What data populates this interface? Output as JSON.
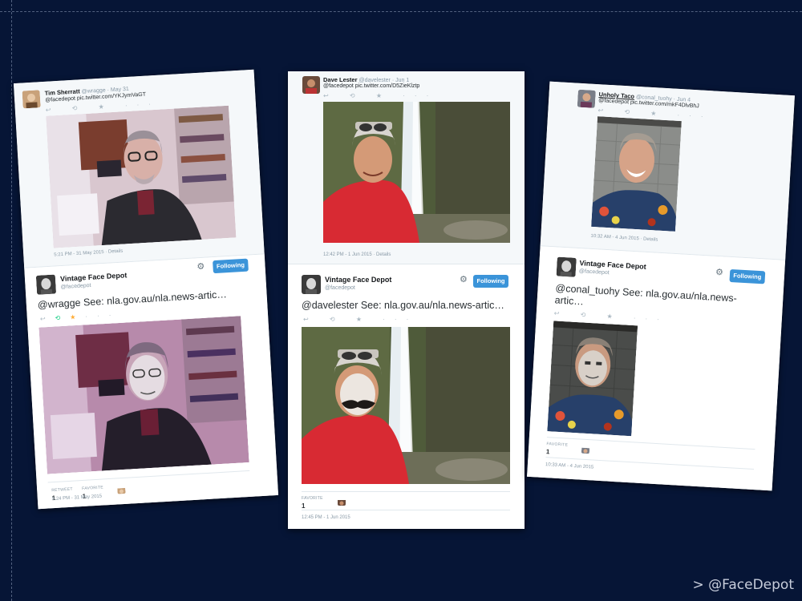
{
  "footer": {
    "label": "> @FaceDepot"
  },
  "tweets": [
    {
      "original": {
        "name": "Tim Sherratt",
        "handle_date": "@wragge · May 31",
        "text": "@facedepot pic.twitter.com/YKJymVaGT",
        "timestamp": "5:21 PM - 31 May 2015 · Details"
      },
      "reply": {
        "name": "Vintage Face Depot",
        "handle": "@facedepot",
        "follow_label": "Following",
        "text": "@wragge See: nla.gov.au/nla.news-artic…",
        "stats": [
          {
            "label": "RETWEET",
            "value": "1"
          },
          {
            "label": "FAVORITE",
            "value": "1"
          }
        ],
        "timestamp": "5:24 PM - 31 May 2015"
      }
    },
    {
      "original": {
        "name": "Dave Lester",
        "handle_date": "@davelester · Jun 1",
        "text": "@facedepot pic.twitter.com/D5ZieKlztp",
        "timestamp": "12:42 PM - 1 Jun 2015 · Details"
      },
      "reply": {
        "name": "Vintage Face Depot",
        "handle": "@facedepot",
        "follow_label": "Following",
        "text": "@davelester See: nla.gov.au/nla.news-artic…",
        "stats": [
          {
            "label": "FAVORITE",
            "value": "1"
          }
        ],
        "timestamp": "12:45 PM - 1 Jun 2015"
      }
    },
    {
      "original": {
        "name": "Unholy Taco",
        "handle_date": "@conal_tuohy · Jun 4",
        "text": "@facedepot pic.twitter.com/mkF4DlvBhJ",
        "timestamp": "10:32 AM - 4 Jun 2015 · Details"
      },
      "reply": {
        "name": "Vintage Face Depot",
        "handle": "@facedepot",
        "follow_label": "Following",
        "text_line1": "@conal_tuohy See: nla.gov.au/nla.news-",
        "text_line2": "artic…",
        "stats": [
          {
            "label": "FAVORITE",
            "value": "1"
          }
        ],
        "timestamp": "10:33 AM - 4 Jun 2015"
      }
    }
  ],
  "icons": {
    "actions": "↩ ⟲ ★ ···",
    "gear": "⚙"
  }
}
